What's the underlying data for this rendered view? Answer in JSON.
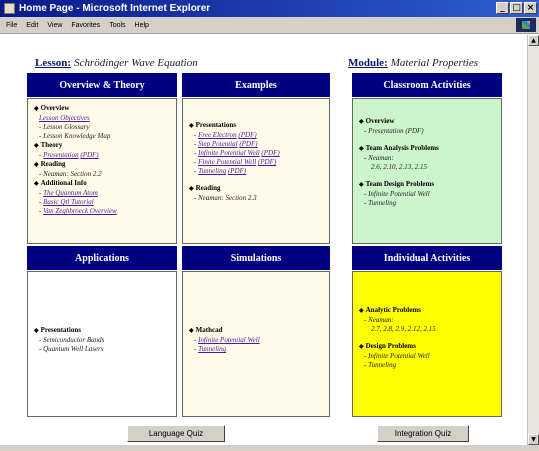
{
  "window": {
    "title": "Home Page - Microsoft Internet Explorer",
    "min": "_",
    "max": "□",
    "close": "×"
  },
  "menu": [
    "File",
    "Edit",
    "View",
    "Favorites",
    "Tools",
    "Help"
  ],
  "lesson": {
    "label": "Lesson:",
    "value": "Schrödinger Wave Equation"
  },
  "module": {
    "label": "Module:",
    "value": "Material Properties"
  },
  "columns": {
    "overview": "Overview & Theory",
    "examples": "Examples",
    "classroom": "Classroom Activities",
    "applications": "Applications",
    "simulations": "Simulations",
    "individual": "Individual Activities"
  },
  "overview": {
    "h1": "Overview",
    "link1": "Lesson Objectives",
    "item1": "- Lesson Glossary",
    "item2": "- Lesson Knowledge Map",
    "h2": "Theory",
    "link2": "Presentation",
    "link2b": "(PDF)",
    "h3": "Reading",
    "item3": "- Neaman: Section 2.2",
    "h4": "Additional Info",
    "link4a": "The Quantum Atom",
    "link4b": "Basic Qtl Tutorial",
    "link4c": "Van Zeghbroeck Overview"
  },
  "examples": {
    "h1": "Presentations",
    "l1": "Free Electron",
    "l1p": "(PDF)",
    "l2": "Step Potential",
    "l2p": "(PDF)",
    "l3": "Infinite Potential Well",
    "l3p": "(PDF)",
    "l4": "Finite Potential Well",
    "l4p": "(PDF)",
    "l5": "Tunneling",
    "l5p": "(PDF)",
    "h2": "Reading",
    "item": "- Neaman: Section 2.3"
  },
  "classroom": {
    "h1": "Overview",
    "i1": "- Presentation (PDF)",
    "h2": "Team Analysis Problems",
    "i2": "- Neaman:",
    "i3": "2.6, 2.10, 2.13, 2.15",
    "h3": "Team Design Problems",
    "i4": "- Infinite Potential Well",
    "i5": "- Tunneling"
  },
  "applications": {
    "h1": "Presentations",
    "i1": "- Semiconductor Bands",
    "i2": "- Quantum Well Lasers"
  },
  "simulations": {
    "h1": "Mathcad",
    "l1": "Infinite Potential Well",
    "l2": "Tunneling"
  },
  "individual": {
    "h1": "Analytic Problems",
    "i1": "- Neaman:",
    "i2": "2.7, 2.8, 2.9, 2.12, 2.15",
    "h2": "Design Problems",
    "i3": "- Infinite Potential Well",
    "i4": "- Tunneling"
  },
  "buttons": {
    "language_quiz": "Language Quiz",
    "integration_quiz": "Integration Quiz"
  }
}
